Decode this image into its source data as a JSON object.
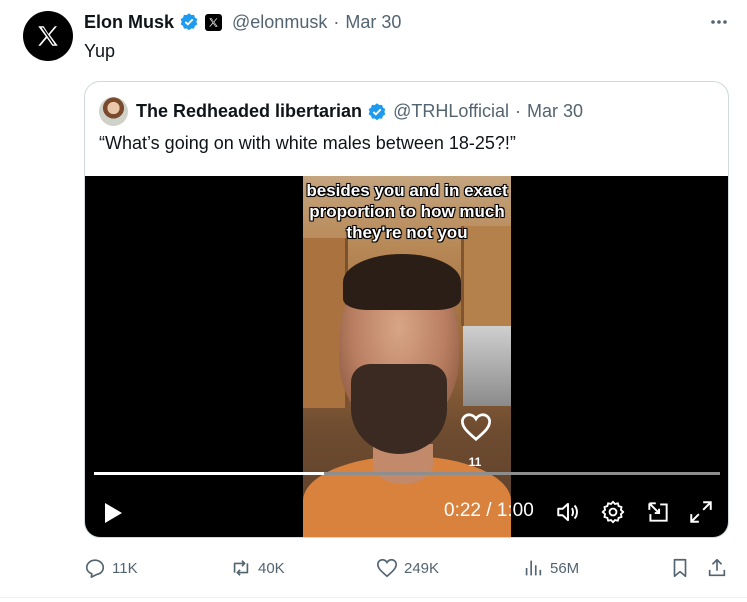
{
  "post": {
    "author_name": "Elon Musk",
    "author_handle": "@elonmusk",
    "date": "Mar 30",
    "text": "Yup"
  },
  "quote": {
    "author_name": "The Redheaded libertarian",
    "author_handle": "@TRHLofficial",
    "date": "Mar 30",
    "text": "“What’s going on with white males between 18-25?!”",
    "video": {
      "caption_lines": [
        "besides you and in exact",
        "proportion to how much",
        "they're not you"
      ],
      "like_count": "11",
      "time_display": "0:22 / 1:00",
      "progress_fraction": 0.367
    }
  },
  "actions": {
    "replies": "11K",
    "reposts": "40K",
    "likes": "249K",
    "views": "56M"
  },
  "colors": {
    "verified": "#1d9bf0",
    "muted": "#536471",
    "border": "#cfd9de"
  }
}
